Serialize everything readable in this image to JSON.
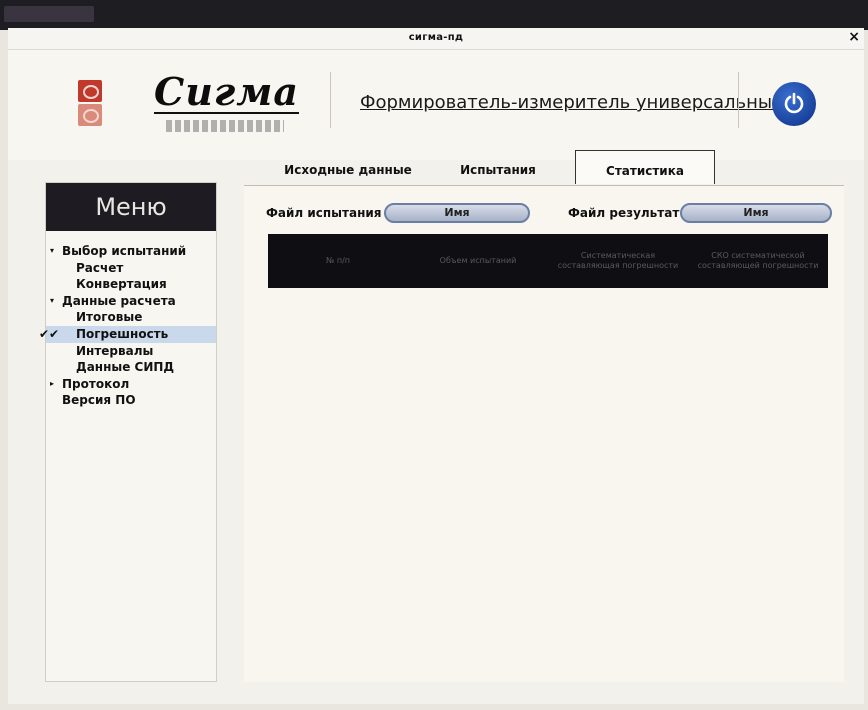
{
  "window": {
    "title": "сигма-пд",
    "close_label": "×"
  },
  "header": {
    "logo_text": "Сигма",
    "app_name": "Формирователь-измеритель универсальный"
  },
  "tabs": [
    {
      "label": "Исходные данные"
    },
    {
      "label": "Испытания"
    },
    {
      "label": "Статистика",
      "active": true
    }
  ],
  "sidebar": {
    "title": "Меню",
    "items": [
      {
        "label": "Выбор испытаний",
        "level": 0,
        "expander": "▾"
      },
      {
        "label": "Расчет",
        "level": 1
      },
      {
        "label": "Конвертация",
        "level": 1
      },
      {
        "label": "Данные расчета",
        "level": 0,
        "expander": "▾"
      },
      {
        "label": "Итоговые",
        "level": 1
      },
      {
        "label": "Погрешность",
        "level": 1,
        "selected": true,
        "check": "✔✔"
      },
      {
        "label": "Интервалы",
        "level": 1
      },
      {
        "label": "Данные СИПД",
        "level": 1
      },
      {
        "label": "Протокол",
        "level": 0,
        "expander": "▸"
      },
      {
        "label": "Версия ПО",
        "level": 0
      }
    ]
  },
  "files": {
    "test_label": "Файл испытания",
    "test_button": "Имя",
    "result_label": "Файл результат",
    "result_button": "Имя"
  },
  "table": {
    "headers": [
      "№ п/п",
      "Объем испытаний",
      "Систематическая составляющая погрешности",
      "СКО систематической составляющей погрешности"
    ]
  },
  "colors": {
    "menu_header": "#1e1b22",
    "table_header": "#0f0e12",
    "selected_row": "#c9d8ea",
    "logo_red": "#c0392b",
    "power_blue": "#0c2f86"
  }
}
